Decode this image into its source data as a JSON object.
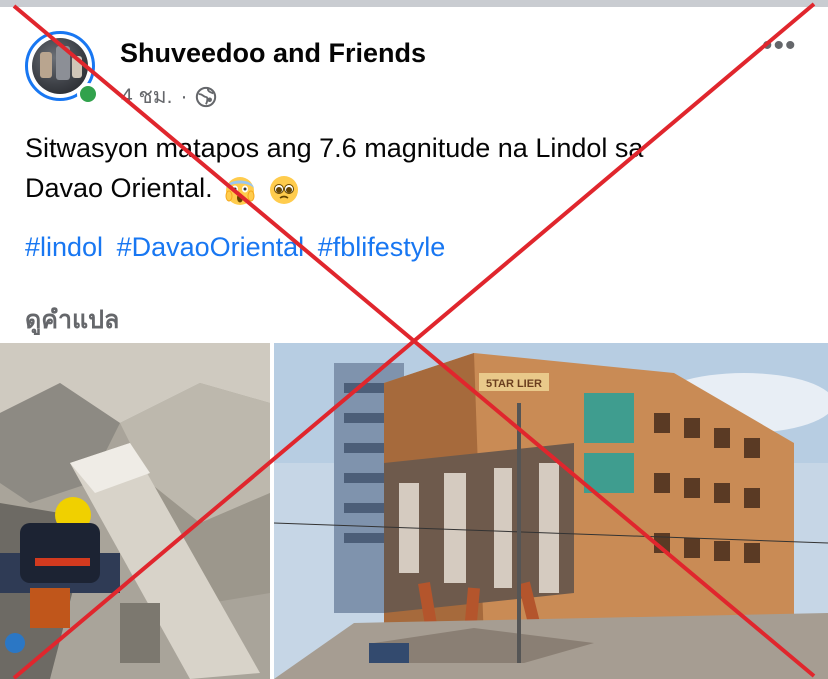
{
  "post": {
    "page_name": "Shuveedoo and Friends",
    "time": "4 ชม.",
    "separator": "·",
    "privacy_icon": "globe-icon",
    "more_icon": "more-options-icon",
    "text_line1": "Sitwasyon matapos ang 7.6 magnitude na Lindol sa",
    "text_line2": "Davao Oriental.",
    "emojis": [
      "face-screaming-in-fear",
      "pleading-face"
    ],
    "hashtags": [
      "#lindol",
      "#DavaoOriental",
      "#fblifestyle"
    ],
    "translate_label": "ดูคำแปล",
    "photo_left": "rescuer-in-rubble-photo",
    "photo_right": "collapsed-building-photo",
    "building_sign": "5TAR LIER"
  },
  "colors": {
    "link": "#1877f2",
    "secondary_text": "#65676b",
    "online": "#31a24c",
    "overlay_x": "#e0262d"
  }
}
